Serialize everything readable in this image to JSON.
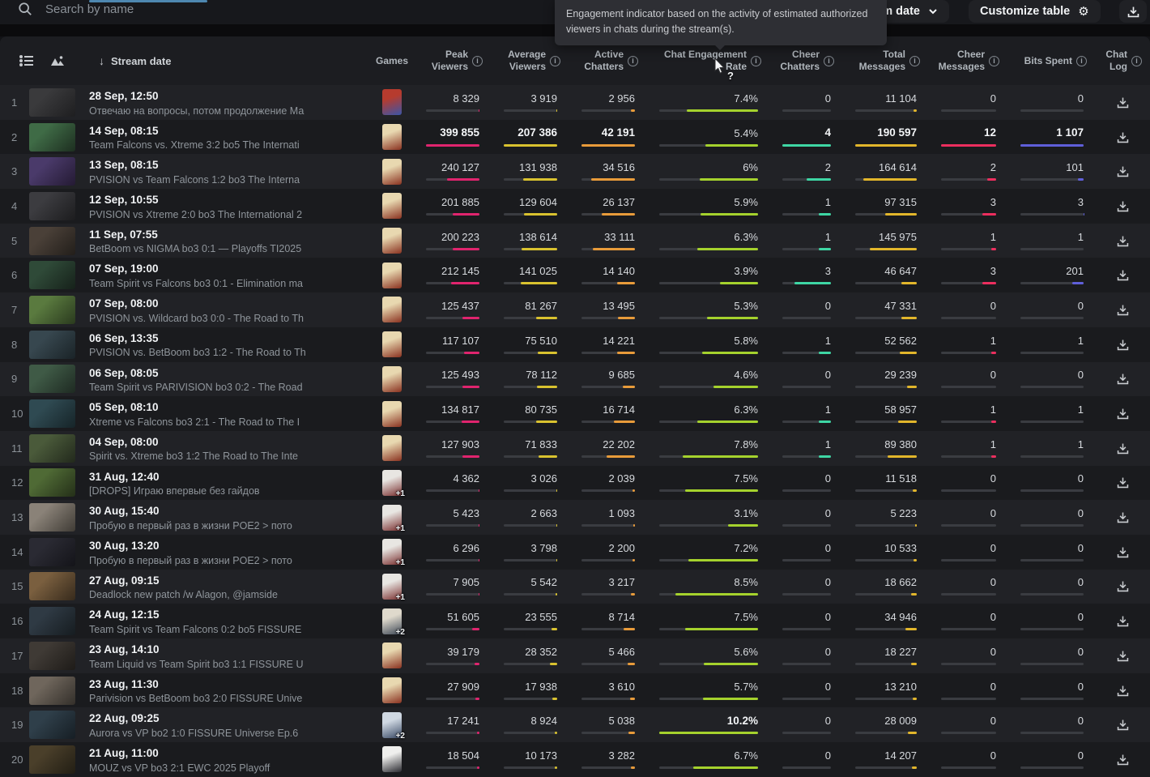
{
  "topbar": {
    "search_placeholder": "Search by name",
    "filter_label": "m date",
    "customize_label": "Customize table",
    "tab_indicator_color": "#4e87b0"
  },
  "tooltip": {
    "text": "Engagement indicator based on the activity of estimated authorized viewers in chats during the stream(s)."
  },
  "header": {
    "stream_date": "Stream date",
    "games": "Games",
    "metrics": [
      {
        "key": "peak",
        "l1": "Peak",
        "l2": "Viewers"
      },
      {
        "key": "avg",
        "l1": "Average",
        "l2": "Viewers"
      },
      {
        "key": "active",
        "l1": "Active",
        "l2": "Chatters"
      },
      {
        "key": "eng",
        "l1": "Chat Engagement",
        "l2": "Rate"
      },
      {
        "key": "cheer_ch",
        "l1": "Cheer",
        "l2": "Chatters"
      },
      {
        "key": "total_msg",
        "l1": "Total",
        "l2": "Messages"
      },
      {
        "key": "cheer_msg",
        "l1": "Cheer",
        "l2": "Messages"
      },
      {
        "key": "bits",
        "l1": "Bits Spent",
        "l2": ""
      },
      {
        "key": "chat_log",
        "l1": "Chat Log",
        "l2": ""
      }
    ]
  },
  "bar_colors": {
    "peak": "#e0246e",
    "avg": "#d9c22f",
    "active": "#e89b3a",
    "eng": "#a5d22d",
    "cheer_ch": "#3ed6a4",
    "total_msg": "#e2b62b",
    "cheer_msg": "#ec2e5e",
    "bits": "#5f5fd9"
  },
  "rows": [
    {
      "num": "1",
      "date": "28 Sep, 12:50",
      "title": "Отвечаю на вопросы, потом продолжение Ма",
      "thumb": [
        "#3a3a3c",
        "#1e1e20"
      ],
      "game": {
        "c1": "#b63b2e",
        "c2": "#3b55a8",
        "badge": ""
      },
      "peak": "8 329",
      "avg": "3 919",
      "active": "2 956",
      "eng": "7.4%",
      "cheer_ch": "0",
      "total_msg": "11 104",
      "cheer_msg": "0",
      "bits": "0"
    },
    {
      "num": "2",
      "date": "14 Sep, 08:15",
      "title": "Team Falcons vs. Xtreme 3:2 bo5 The Internati",
      "thumb": [
        "#3f6b46",
        "#1d2e20"
      ],
      "game": {
        "c1": "#e8d8b0",
        "c2": "#8a3220",
        "badge": ""
      },
      "peak": "399 855",
      "avg": "207 386",
      "active": "42 191",
      "eng": "5.4%",
      "cheer_ch": "4",
      "total_msg": "190 597",
      "cheer_msg": "12",
      "bits": "1 107"
    },
    {
      "num": "3",
      "date": "13 Sep, 08:15",
      "title": "PVISION vs Team Falcons 1:2 bo3 The Interna",
      "thumb": [
        "#4a3a6a",
        "#241a33"
      ],
      "game": {
        "c1": "#e8d8b0",
        "c2": "#8a3220",
        "badge": ""
      },
      "peak": "240 127",
      "avg": "131 938",
      "active": "34 516",
      "eng": "6%",
      "cheer_ch": "2",
      "total_msg": "164 614",
      "cheer_msg": "2",
      "bits": "101"
    },
    {
      "num": "4",
      "date": "12 Sep, 10:55",
      "title": "PVISION vs Xtreme 2:0 bo3 The International 2",
      "thumb": [
        "#3c3c40",
        "#1c1c1e"
      ],
      "game": {
        "c1": "#e8d8b0",
        "c2": "#8a3220",
        "badge": ""
      },
      "peak": "201 885",
      "avg": "129 604",
      "active": "26 137",
      "eng": "5.9%",
      "cheer_ch": "1",
      "total_msg": "97 315",
      "cheer_msg": "3",
      "bits": "3"
    },
    {
      "num": "5",
      "date": "11 Sep, 07:55",
      "title": "BetBoom vs NIGMA bo3 0:1 — Playoffs TI2025",
      "thumb": [
        "#4a4038",
        "#221e1a"
      ],
      "game": {
        "c1": "#e8d8b0",
        "c2": "#8a3220",
        "badge": ""
      },
      "peak": "200 223",
      "avg": "138 614",
      "active": "33 111",
      "eng": "6.3%",
      "cheer_ch": "1",
      "total_msg": "145 975",
      "cheer_msg": "1",
      "bits": "1"
    },
    {
      "num": "6",
      "date": "07 Sep, 19:00",
      "title": "Team Spirit vs Falcons bo3 0:1 - Elimination ma",
      "thumb": [
        "#2f4a38",
        "#16211a"
      ],
      "game": {
        "c1": "#e8d8b0",
        "c2": "#8a3220",
        "badge": ""
      },
      "peak": "212 145",
      "avg": "141 025",
      "active": "14 140",
      "eng": "3.9%",
      "cheer_ch": "3",
      "total_msg": "46 647",
      "cheer_msg": "3",
      "bits": "201"
    },
    {
      "num": "7",
      "date": "07 Sep, 08:00",
      "title": "PVISION vs. Wildcard bo3 0:0 - The Road to Th",
      "thumb": [
        "#5a7a3f",
        "#2a3a1e"
      ],
      "game": {
        "c1": "#e8d8b0",
        "c2": "#8a3220",
        "badge": ""
      },
      "peak": "125 437",
      "avg": "81 267",
      "active": "13 495",
      "eng": "5.3%",
      "cheer_ch": "0",
      "total_msg": "47 331",
      "cheer_msg": "0",
      "bits": "0"
    },
    {
      "num": "8",
      "date": "06 Sep, 13:35",
      "title": "PVISION vs. BetBoom bo3 1:2 - The Road to Th",
      "thumb": [
        "#37474f",
        "#1a2327"
      ],
      "game": {
        "c1": "#e8d8b0",
        "c2": "#8a3220",
        "badge": ""
      },
      "peak": "117 107",
      "avg": "75 510",
      "active": "14 221",
      "eng": "5.8%",
      "cheer_ch": "1",
      "total_msg": "52 562",
      "cheer_msg": "1",
      "bits": "1"
    },
    {
      "num": "9",
      "date": "06 Sep, 08:05",
      "title": "Team Spirit vs PARIVISION bo3 0:2 - The Road",
      "thumb": [
        "#3f5a46",
        "#1e2a22"
      ],
      "game": {
        "c1": "#e8d8b0",
        "c2": "#8a3220",
        "badge": ""
      },
      "peak": "125 493",
      "avg": "78 112",
      "active": "9 685",
      "eng": "4.6%",
      "cheer_ch": "0",
      "total_msg": "29 239",
      "cheer_msg": "0",
      "bits": "0"
    },
    {
      "num": "10",
      "date": "05 Sep, 08:10",
      "title": "Xtreme vs Falcons bo3 2:1 - The Road to The I",
      "thumb": [
        "#2f4a52",
        "#162428"
      ],
      "game": {
        "c1": "#e8d8b0",
        "c2": "#8a3220",
        "badge": ""
      },
      "peak": "134 817",
      "avg": "80 735",
      "active": "16 714",
      "eng": "6.3%",
      "cheer_ch": "1",
      "total_msg": "58 957",
      "cheer_msg": "1",
      "bits": "1"
    },
    {
      "num": "11",
      "date": "04 Sep, 08:00",
      "title": "Spirit vs. Xtreme bo3 1:2 The Road to The Inte",
      "thumb": [
        "#4a5a3a",
        "#22291c"
      ],
      "game": {
        "c1": "#e8d8b0",
        "c2": "#8a3220",
        "badge": ""
      },
      "peak": "127 903",
      "avg": "71 833",
      "active": "22 202",
      "eng": "7.8%",
      "cheer_ch": "1",
      "total_msg": "89 380",
      "cheer_msg": "1",
      "bits": "1"
    },
    {
      "num": "12",
      "date": "31 Aug, 12:40",
      "title": "[DROPS] Играю впервые без гайдов",
      "thumb": [
        "#4f6a35",
        "#242f18"
      ],
      "game": {
        "c1": "#e8e6e2",
        "c2": "#7a2f2f",
        "badge": "+1"
      },
      "peak": "4 362",
      "avg": "3 026",
      "active": "2 039",
      "eng": "7.5%",
      "cheer_ch": "0",
      "total_msg": "11 518",
      "cheer_msg": "0",
      "bits": "0"
    },
    {
      "num": "13",
      "date": "30 Aug, 15:40",
      "title": "Пробую в первый раз в жизни POE2 > пото",
      "thumb": [
        "#8a8278",
        "#3f3b35"
      ],
      "game": {
        "c1": "#e8e6e2",
        "c2": "#7a2f2f",
        "badge": "+1"
      },
      "peak": "5 423",
      "avg": "2 663",
      "active": "1 093",
      "eng": "3.1%",
      "cheer_ch": "0",
      "total_msg": "5 223",
      "cheer_msg": "0",
      "bits": "0"
    },
    {
      "num": "14",
      "date": "30 Aug, 13:20",
      "title": "Пробую в первый раз в жизни POE2 > пото",
      "thumb": [
        "#2a2a33",
        "#141419"
      ],
      "game": {
        "c1": "#e8e6e2",
        "c2": "#7a2f2f",
        "badge": "+1"
      },
      "peak": "6 296",
      "avg": "3 798",
      "active": "2 200",
      "eng": "7.2%",
      "cheer_ch": "0",
      "total_msg": "10 533",
      "cheer_msg": "0",
      "bits": "0"
    },
    {
      "num": "15",
      "date": "27 Aug, 09:15",
      "title": "Deadlock new patch /w Alagon, @jamside",
      "thumb": [
        "#7a5f3f",
        "#362a1c"
      ],
      "game": {
        "c1": "#e8e6e2",
        "c2": "#7a2f2f",
        "badge": "+1"
      },
      "peak": "7 905",
      "avg": "5 542",
      "active": "3 217",
      "eng": "8.5%",
      "cheer_ch": "0",
      "total_msg": "18 662",
      "cheer_msg": "0",
      "bits": "0"
    },
    {
      "num": "16",
      "date": "24 Aug, 12:15",
      "title": "Team Spirit vs Team Falcons 0:2 bo5 FISSURE",
      "thumb": [
        "#2f3a44",
        "#161c20"
      ],
      "game": {
        "c1": "#dfd9cc",
        "c2": "#404a58",
        "badge": "+2"
      },
      "peak": "51 605",
      "avg": "23 555",
      "active": "8 714",
      "eng": "7.5%",
      "cheer_ch": "0",
      "total_msg": "34 946",
      "cheer_msg": "0",
      "bits": "0"
    },
    {
      "num": "17",
      "date": "23 Aug, 14:10",
      "title": "Team Liquid vs Team Spirit bo3 1:1 FISSURE U",
      "thumb": [
        "#3f3a35",
        "#1e1b18"
      ],
      "game": {
        "c1": "#e8d8b0",
        "c2": "#8a3220",
        "badge": ""
      },
      "peak": "39 179",
      "avg": "28 352",
      "active": "5 466",
      "eng": "5.6%",
      "cheer_ch": "0",
      "total_msg": "18 227",
      "cheer_msg": "0",
      "bits": "0"
    },
    {
      "num": "18",
      "date": "23 Aug, 11:30",
      "title": "Parivision vs BetBoom bo3 2:0 FISSURE Unive",
      "thumb": [
        "#6f665c",
        "#332f2a"
      ],
      "game": {
        "c1": "#e8d8b0",
        "c2": "#8a3220",
        "badge": ""
      },
      "peak": "27 909",
      "avg": "17 938",
      "active": "3 610",
      "eng": "5.7%",
      "cheer_ch": "0",
      "total_msg": "13 210",
      "cheer_msg": "0",
      "bits": "0"
    },
    {
      "num": "19",
      "date": "22 Aug, 09:25",
      "title": "Aurora vs VP bo2 1:0 FISSURE Universe Ep.6",
      "thumb": [
        "#2f3f4a",
        "#161e24"
      ],
      "game": {
        "c1": "#cfd8e2",
        "c2": "#3a4a66",
        "badge": "+2"
      },
      "peak": "17 241",
      "avg": "8 924",
      "active": "5 038",
      "eng": "10.2%",
      "cheer_ch": "0",
      "total_msg": "28 009",
      "cheer_msg": "0",
      "bits": "0"
    },
    {
      "num": "20",
      "date": "21 Aug, 11:00",
      "title": "MOUZ vs VP bo3 2:1 EWC 2025 Playoff",
      "thumb": [
        "#4a3f2a",
        "#221e14"
      ],
      "game": {
        "c1": "#efefed",
        "c2": "#2a2a30",
        "badge": ""
      },
      "peak": "18 504",
      "avg": "10 173",
      "active": "3 282",
      "eng": "6.7%",
      "cheer_ch": "0",
      "total_msg": "14 207",
      "cheer_msg": "0",
      "bits": "0"
    }
  ]
}
